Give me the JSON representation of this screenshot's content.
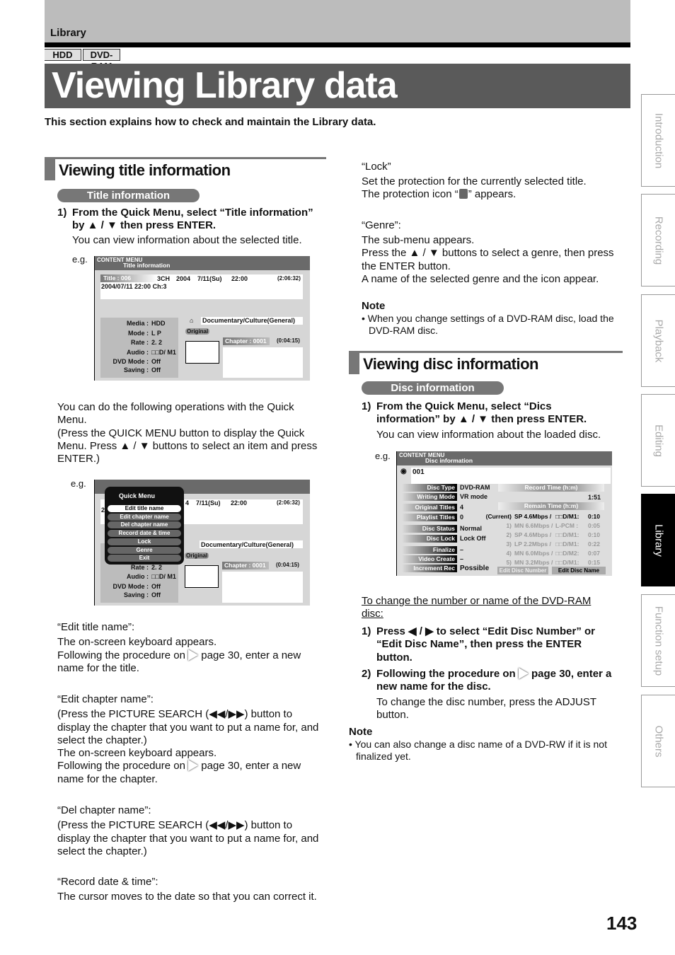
{
  "header": {
    "section": "Library",
    "media_tags": [
      "HDD",
      "DVD-RAM"
    ],
    "title": "Viewing Library data",
    "intro": "This section explains how to check and maintain the Library data."
  },
  "side_tabs": [
    {
      "label": "Introduction",
      "active": false
    },
    {
      "label": "Recording",
      "active": false
    },
    {
      "label": "Playback",
      "active": false
    },
    {
      "label": "Editing",
      "active": false
    },
    {
      "label": "Library",
      "active": true
    },
    {
      "label": "Function setup",
      "active": false
    },
    {
      "label": "Others",
      "active": false
    }
  ],
  "left": {
    "heading": "Viewing title information",
    "pill": "Title information",
    "step1": {
      "num": "1)",
      "text": "From the Quick Menu, select “Title information” by ▲ / ▼ then press ENTER.",
      "sub": "You can view information about the selected title."
    },
    "eg": "e.g.",
    "para": "You can do the following operations with the Quick Menu.\n(Press the QUICK MENU button to display the Quick Menu. Press ▲ / ▼ buttons to select an item and press ENTER.)",
    "items": [
      {
        "title": "“Edit title name”:",
        "lines": [
          "The on-screen keyboard appears.",
          "Following the procedure on",
          "page 30, enter a new name for the title."
        ]
      },
      {
        "title": "“Edit chapter name”:",
        "lines": [
          "(Press the PICTURE SEARCH (◀◀/▶▶) button to display the chapter that you want to put a name for, and select the chapter.)",
          "The on-screen keyboard appears.",
          "Following the procedure on",
          "page 30, enter a new name for the chapter."
        ]
      },
      {
        "title": "“Del chapter name”:",
        "lines": [
          "(Press the PICTURE SEARCH (◀◀/▶▶) button to display the chapter that you want to put a name for, and select the chapter.)"
        ]
      },
      {
        "title": "“Record date & time”:",
        "lines": [
          "The cursor moves to the date so that you can correct it."
        ]
      }
    ]
  },
  "title_screen": {
    "logo": "CONTENT MENU",
    "header": "Title information",
    "title_no": "Title : 006",
    "channel": "3CH",
    "year": "2004",
    "date": "7/11(Su)",
    "time": "22:00",
    "duration": "(2:06:32)",
    "name": "2004/07/11  22:00  Ch:3",
    "fields": [
      {
        "label": "Media :",
        "value": "HDD"
      },
      {
        "label": "Mode :",
        "value": "L P"
      },
      {
        "label": "Rate :",
        "value": "2. 2"
      },
      {
        "label": "Audio :",
        "value": "□□D/ M1"
      },
      {
        "label": "DVD Mode :",
        "value": "Off"
      },
      {
        "label": "Saving :",
        "value": "Off"
      }
    ],
    "genre": "Documentary/Culture(General)",
    "original": "Original",
    "chapter": "Chapter :  0001",
    "chapter_time": "(0:04:15)"
  },
  "quick_menu": {
    "header": "Quick Menu",
    "items": [
      "Edit title name",
      "Edit chapter name",
      "Del chapter name",
      "Record date & time",
      "Lock",
      "Genre",
      "Exit"
    ],
    "selected": 0,
    "bg_cut": "4",
    "bg_date": "7/11(Su)",
    "bg_time": "22:00",
    "bg_duration": "(2:06:32)",
    "bg_num": "2"
  },
  "right": {
    "lock": {
      "title": "“Lock”",
      "lines": [
        "Set the protection for the currently selected title.",
        "The protection icon “",
        "” appears."
      ]
    },
    "genre": {
      "title": "“Genre”:",
      "lines": [
        "The sub-menu appears.",
        "Press the ▲ / ▼ buttons to select a genre, then press the ENTER button.",
        "A name of the selected genre and the icon appear."
      ]
    },
    "note1": {
      "title": "Note",
      "text": "When you change settings of a DVD-RAM disc, load the DVD-RAM disc."
    },
    "heading": "Viewing disc information",
    "pill": "Disc information",
    "step1": {
      "num": "1)",
      "text": "From the Quick Menu, select “Dics information” by ▲ / ▼ then press ENTER.",
      "sub": "You can view information about the loaded disc."
    },
    "eg": "e.g.",
    "change_link": "To change the number or name of the DVD-RAM disc:",
    "step_a": {
      "num": "1)",
      "text": "Press ◀ / ▶ to select “Edit Disc Number” or “Edit Disc Name”, then press the ENTER button."
    },
    "step_b": {
      "num": "2)",
      "text_a": "Following the procedure on",
      "text_b": "page 30, enter a new name for the disc.",
      "sub": "To change the disc number, press the ADJUST button."
    },
    "note2": {
      "title": "Note",
      "text": "You can also change a disc name of a DVD-RW if it is not finalized yet."
    }
  },
  "disc_screen": {
    "logo": "CONTENT MENU",
    "header": "Disc information",
    "disc_no": "001",
    "fields": [
      {
        "label": "Disc Type",
        "value": "DVD-RAM"
      },
      {
        "label": "Writing Mode",
        "value": "VR mode"
      },
      {
        "label": "Original Titles",
        "value": "4"
      },
      {
        "label": "Playlist Titles",
        "value": "0"
      },
      {
        "label": "Disc Status",
        "value": "Normal"
      },
      {
        "label": "Disc Lock",
        "value": "Lock Off"
      },
      {
        "label": "Finalize",
        "value": "–"
      },
      {
        "label": "Video Create",
        "value": "–"
      },
      {
        "label": "Increment Rec",
        "value": "Possible"
      }
    ],
    "record_time_label": "Record Time (h:m)",
    "record_time": "1:51",
    "remain_label": "Remain Time (h:m)",
    "remain": [
      {
        "idx": "(Current)",
        "mode": "SP 4.6Mbps /",
        "audio": "□□D/M1:",
        "time": "0:10"
      },
      {
        "idx": "1)",
        "mode": "MN 6.6Mbps /",
        "audio": "L-PCM  :",
        "time": "0:05"
      },
      {
        "idx": "2)",
        "mode": "SP 4.6Mbps /",
        "audio": "□□D/M1:",
        "time": "0:10"
      },
      {
        "idx": "3)",
        "mode": "LP 2.2Mbps /",
        "audio": "□□D/M1:",
        "time": "0:22"
      },
      {
        "idx": "4)",
        "mode": "MN 6.0Mbps /",
        "audio": "□□D/M2:",
        "time": "0:07"
      },
      {
        "idx": "5)",
        "mode": "MN 3.2Mbps /",
        "audio": "□□D/M1:",
        "time": "0:15"
      }
    ],
    "buttons": [
      "Edit Disc Number",
      "Edit Disc Name"
    ]
  },
  "page_number": "143"
}
